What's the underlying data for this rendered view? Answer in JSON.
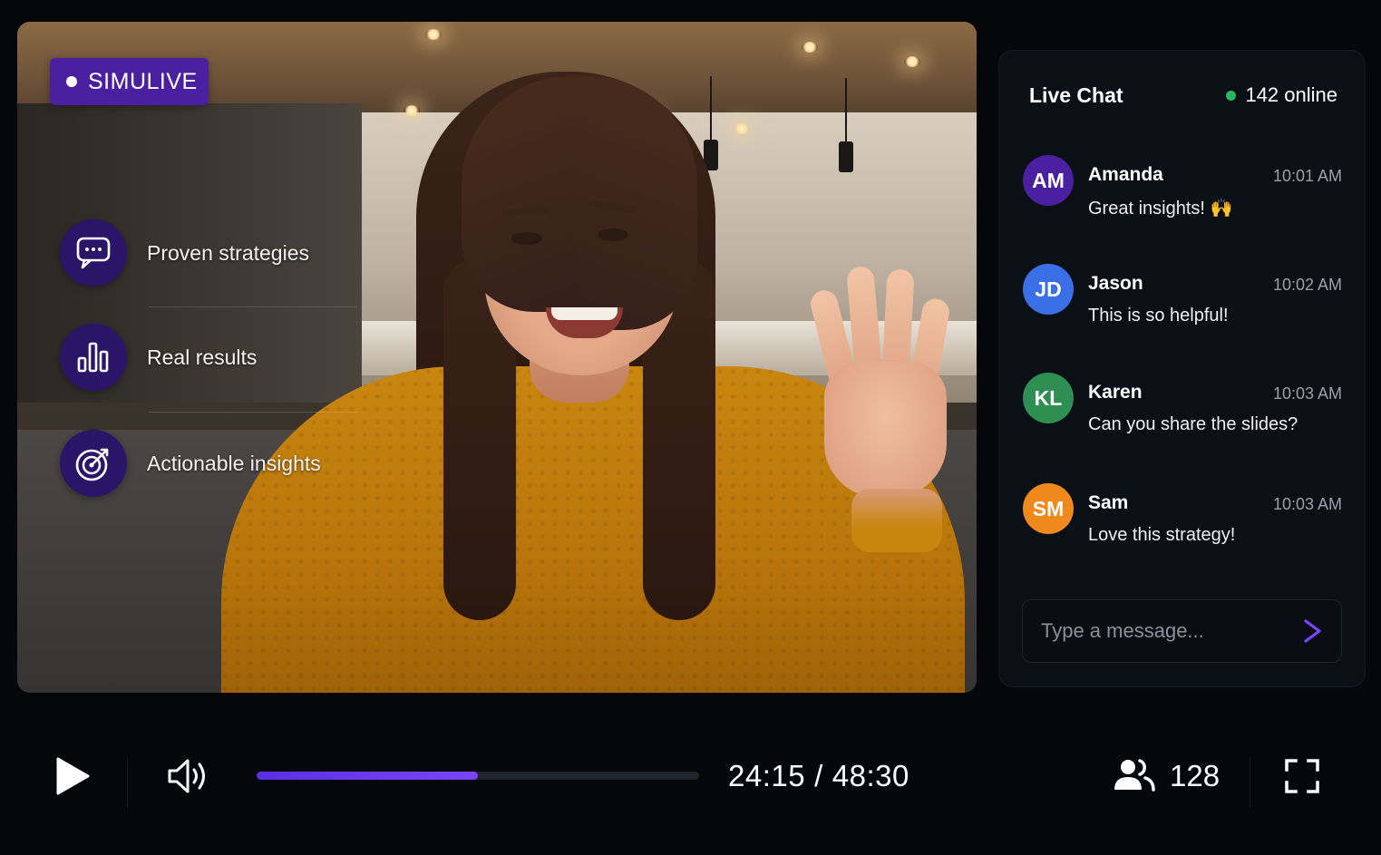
{
  "badge": {
    "label": "SIMULIVE"
  },
  "features": [
    {
      "label": "Proven strategies",
      "icon": "chat-bubble-icon"
    },
    {
      "label": "Real results",
      "icon": "bar-chart-icon"
    },
    {
      "label": "Actionable insights",
      "icon": "target-icon"
    }
  ],
  "chat": {
    "title": "Live Chat",
    "online": "142 online",
    "messages": [
      {
        "initials": "AM",
        "name": "Amanda",
        "time": "10:01 AM",
        "text": "Great insights! 🙌",
        "color": "#4a1fa0"
      },
      {
        "initials": "JD",
        "name": "Jason",
        "time": "10:02 AM",
        "text": "This is so helpful!",
        "color": "#3a6fe8"
      },
      {
        "initials": "KL",
        "name": "Karen",
        "time": "10:03 AM",
        "text": "Can you share the slides?",
        "color": "#2f8f52"
      },
      {
        "initials": "SM",
        "name": "Sam",
        "time": "10:03 AM",
        "text": "Love this strategy!",
        "color": "#f0891c"
      }
    ],
    "input_placeholder": "Type a message...",
    "send_icon": "send-chevron-icon"
  },
  "player": {
    "current_time": "24:15",
    "separator": "/",
    "total_time": "48:30",
    "progress": 0.5,
    "viewers": "128",
    "icons": [
      "play-icon",
      "volume-icon",
      "users-icon",
      "fullscreen-icon"
    ]
  },
  "colors": {
    "accent": "#6a3cf5",
    "badge_bg": "#4a1fa0",
    "online_dot": "#27b564",
    "feature_circle": "#2b1568"
  }
}
